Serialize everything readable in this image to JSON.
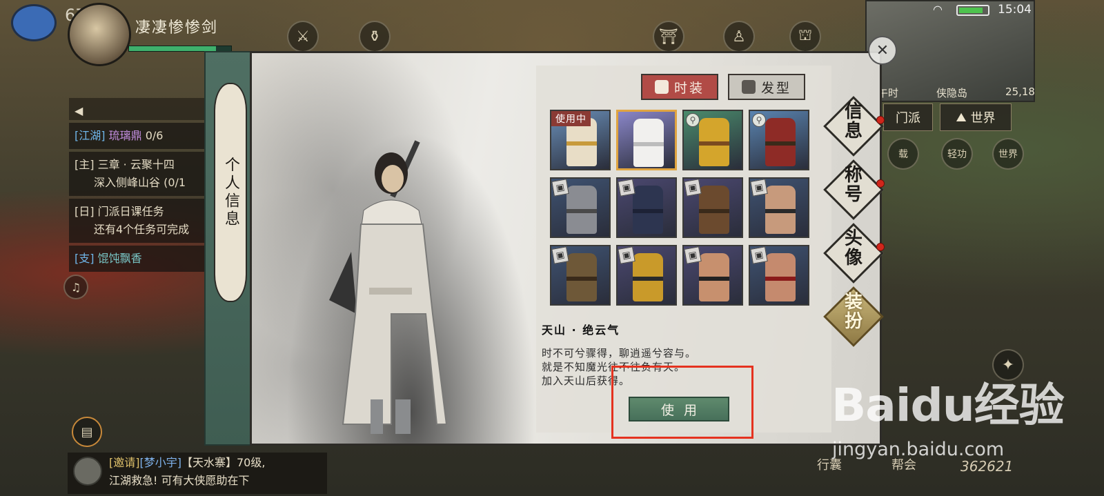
{
  "hud": {
    "level": "67",
    "player_name": "凄凄惨惨剑",
    "hp_fraction": 0.85,
    "clock": "15:04",
    "map_time": "午时",
    "map_location": "侠隐岛",
    "map_coords": "25,18",
    "btn_sect": "门派",
    "btn_world": "世界",
    "btn_ride": "轻功",
    "btn_world2": "世界",
    "btn_carry": "载",
    "bottom_left": "行囊",
    "bottom_mid": "帮会",
    "currency": "362621"
  },
  "quests": [
    {
      "tag": "[江湖]",
      "name": "琉璃鼎",
      "progress": "0/6"
    },
    {
      "tag": "[主]",
      "name": "三章 · 云聚十四",
      "sub": "深入侧峰山谷 (0/1"
    },
    {
      "tag": "[日]",
      "name": "门派日课任务",
      "sub": "还有4个任务可完成"
    },
    {
      "tag": "[支]",
      "name": "馄饨飘香"
    }
  ],
  "chat": {
    "invite": "[邀请]",
    "user": "[梦小宇]",
    "text1": "【天水寨】70级,",
    "text2": "江湖救急! 可有大侠愿助在下"
  },
  "modal": {
    "side_label": "个人信息",
    "tab_fashion": "时装",
    "tab_hair": "发型",
    "in_use_label": "使用中",
    "item_title": "天山 · 绝云气",
    "desc_lines": [
      "时不可兮骤得，聊逍遥兮容与。",
      "就是不知魔光往不往负有天。",
      "加入天山后获得。"
    ],
    "use_button": "使用",
    "outfits": [
      {
        "color": "#e8ddc6",
        "belt": "#c89a3c",
        "bg": "#6a8fb8",
        "state": "in-use"
      },
      {
        "color": "#f1f0ee",
        "belt": "#bcbcbc",
        "bg": "#8a86c8",
        "state": "selected"
      },
      {
        "color": "#d4a52c",
        "belt": "#7a4a20",
        "bg": "#4a8b6c",
        "state": "key"
      },
      {
        "color": "#8e2b26",
        "belt": "#3a2a1a",
        "bg": "#5a84b0",
        "state": "key"
      },
      {
        "color": "#8a8c92",
        "belt": "#4a4a4a",
        "bg": "#3f5372",
        "state": "locked"
      },
      {
        "color": "#2d3550",
        "belt": "#1d2236",
        "bg": "#4b4870",
        "state": "locked"
      },
      {
        "color": "#6b4a2e",
        "belt": "#3a2a1a",
        "bg": "#4b4870",
        "state": "locked"
      },
      {
        "color": "#c79a7c",
        "belt": "#2a2a2a",
        "bg": "#3f5372",
        "state": "locked"
      },
      {
        "color": "#6e5838",
        "belt": "#3a2a1a",
        "bg": "#3f5372",
        "state": "locked"
      },
      {
        "color": "#c99a2a",
        "belt": "#2a2a2a",
        "bg": "#4b4870",
        "state": "locked"
      },
      {
        "color": "#c7906e",
        "belt": "#222222",
        "bg": "#4b4870",
        "state": "locked"
      },
      {
        "color": "#c58a6e",
        "belt": "#8a1a1a",
        "bg": "#3f5372",
        "state": "locked"
      }
    ]
  },
  "side_menu": [
    {
      "label": "信息",
      "active": false
    },
    {
      "label": "称号",
      "active": false
    },
    {
      "label": "头像",
      "active": false
    },
    {
      "label": "装扮",
      "active": true
    }
  ],
  "watermark": {
    "logo": "Baidu经验",
    "url": "jingyan.baidu.com"
  },
  "colors": {
    "fashion_tab": "#b14b46",
    "use_button": "#47705a",
    "selected_border": "#e0a440",
    "highlight": "#e5321f"
  }
}
